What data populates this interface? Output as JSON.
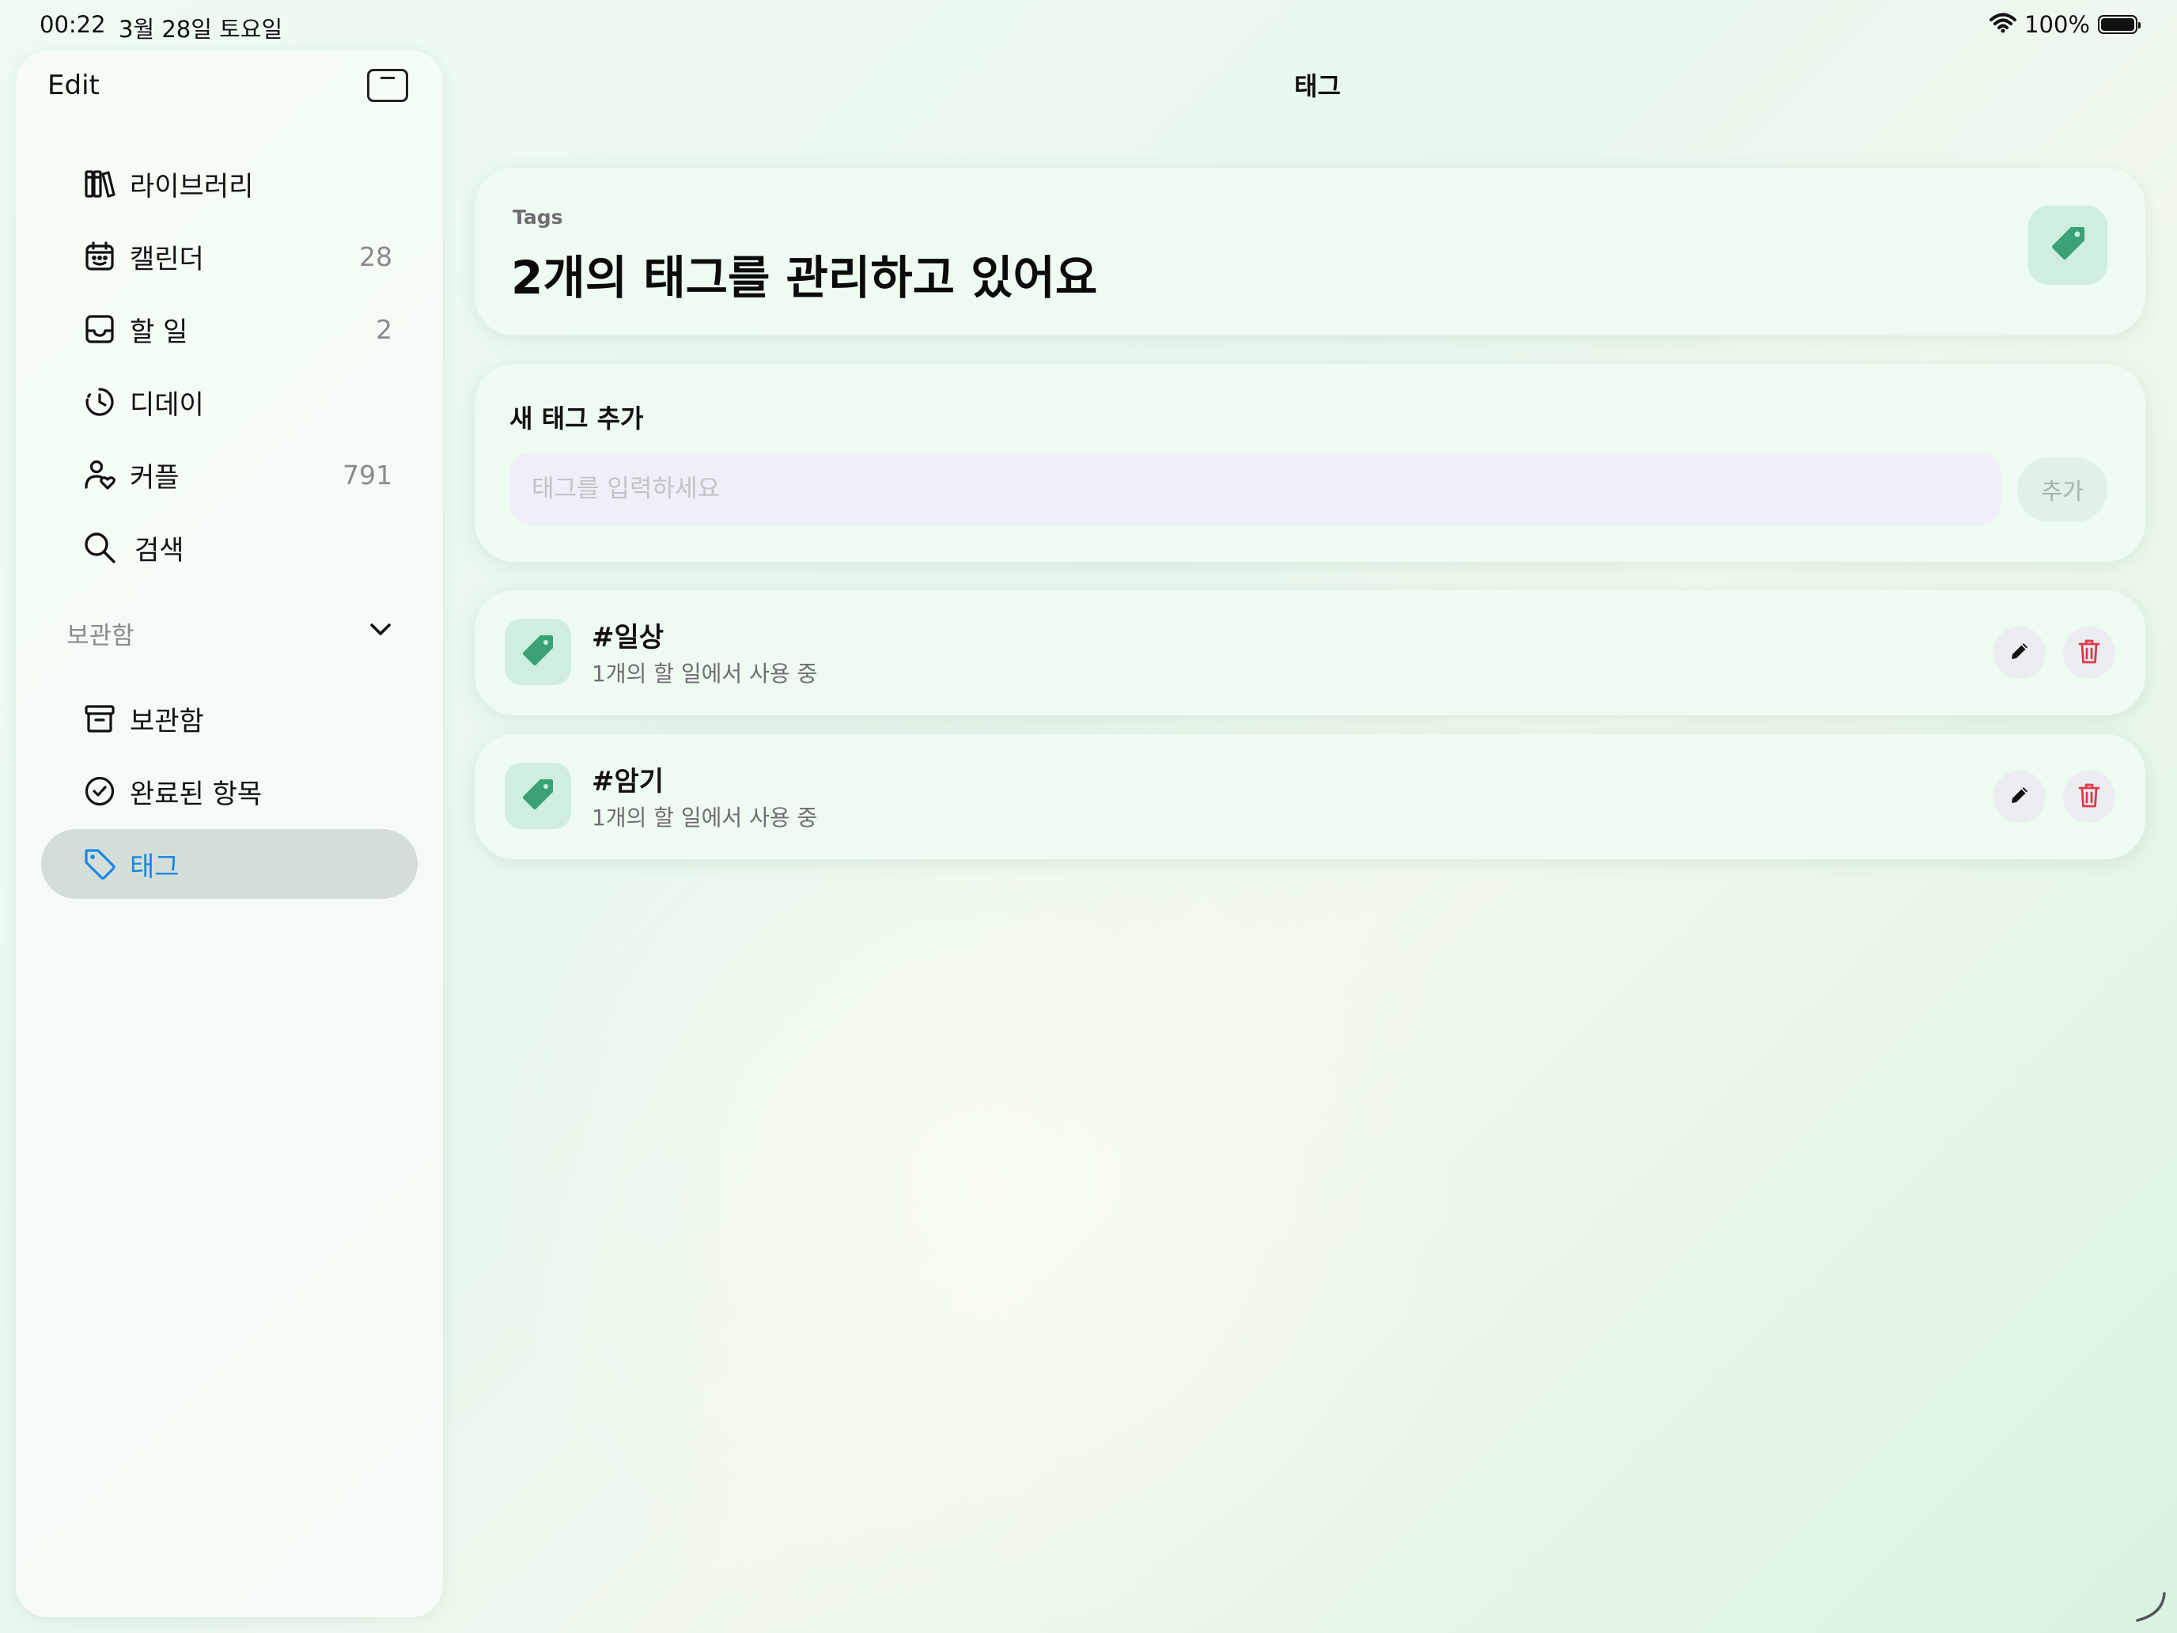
{
  "status_bar": {
    "time": "00:22",
    "date": "3월 28일 토요일",
    "battery": "100%",
    "battery_level": 1.0
  },
  "sidebar": {
    "edit_label": "Edit",
    "items": [
      {
        "label": "라이브러리",
        "icon": "books-icon",
        "count": ""
      },
      {
        "label": "캘린더",
        "icon": "calendar-icon",
        "count": "28"
      },
      {
        "label": "할 일",
        "icon": "inbox-icon",
        "count": "2"
      },
      {
        "label": "디데이",
        "icon": "clock-icon",
        "count": ""
      },
      {
        "label": "커플",
        "icon": "person-heart-icon",
        "count": "791"
      },
      {
        "label": "검색",
        "icon": "search-icon",
        "count": ""
      }
    ],
    "section_label": "보관함",
    "section_items": [
      {
        "label": "보관함",
        "icon": "archive-icon"
      },
      {
        "label": "완료된 항목",
        "icon": "checkmark-circle-icon"
      },
      {
        "label": "태그",
        "icon": "tag-icon",
        "active": true
      }
    ]
  },
  "main": {
    "nav_title": "태그",
    "hero": {
      "eyebrow": "Tags",
      "title": "2개의 태그를 관리하고 있어요"
    },
    "add_tag": {
      "title": "새 태그 추가",
      "placeholder": "태그를 입력하세요",
      "value": "",
      "button_label": "추가"
    },
    "tags": [
      {
        "name": "#일상",
        "usage": "1개의 할 일에서 사용 중"
      },
      {
        "name": "#암기",
        "usage": "1개의 할 일에서 사용 중"
      }
    ]
  },
  "colors": {
    "accent_green": "#3aa273",
    "active_blue": "#1a86e8",
    "delete_red": "#e0394b"
  }
}
